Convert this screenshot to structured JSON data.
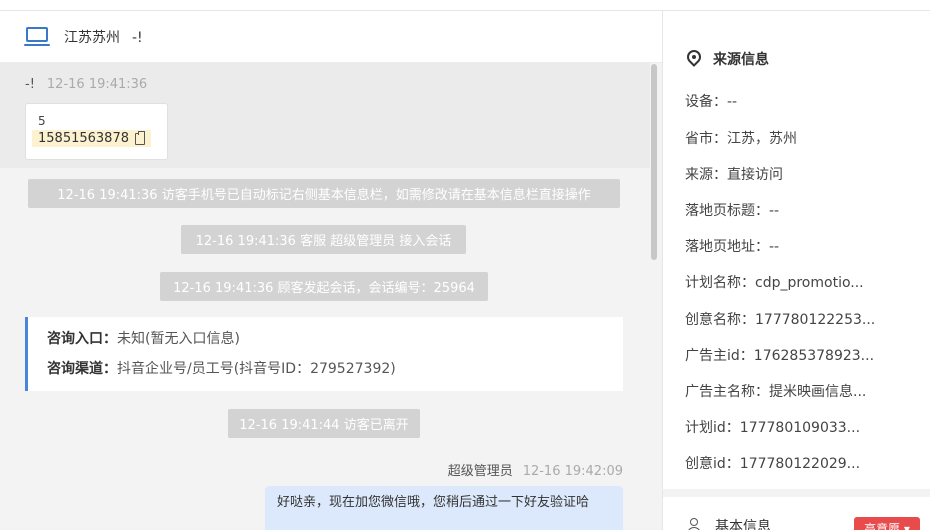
{
  "header": {
    "location": "江苏苏州",
    "suffix": "-!"
  },
  "first_msg": {
    "sender": "-!",
    "time": "12-16 19:41:36",
    "line1": "5",
    "phone": "15851563878"
  },
  "system_messages": [
    "12-16 19:41:36 访客手机号已自动标记右侧基本信息栏，如需修改请在基本信息栏直接操作",
    "12-16 19:41:36 客服 超级管理员 接入会话",
    "12-16 19:41:36 顾客发起会话，会话编号：25964",
    "12-16 19:41:44 访客已离开"
  ],
  "consult": {
    "entry_label": "咨询入口：",
    "entry_value": "未知(暂无入口信息)",
    "channel_label": "咨询渠道：",
    "channel_value": "抖音企业号/员工号(抖音号ID：279527392)"
  },
  "agent_msg": {
    "name": "超级管理员",
    "time": "12-16 19:42:09",
    "text": "好哒亲，现在加您微信哦，您稍后通过一下好友验证哈"
  },
  "side": {
    "title": "来源信息",
    "fields": [
      {
        "label": "设备：",
        "value": "--"
      },
      {
        "label": "省市：",
        "value": "江苏，苏州"
      },
      {
        "label": "来源：",
        "value": "直接访问"
      },
      {
        "label": "落地页标题：",
        "value": "--"
      },
      {
        "label": "落地页地址：",
        "value": "--"
      },
      {
        "label": "计划名称：",
        "value": "cdp_promotio..."
      },
      {
        "label": "创意名称：",
        "value": "177780122253..."
      },
      {
        "label": "广告主id：",
        "value": "176285378923..."
      },
      {
        "label": "广告主名称：",
        "value": "提米映画信息..."
      },
      {
        "label": "计划id：",
        "value": "177780109033..."
      },
      {
        "label": "创意id：",
        "value": "177780122029..."
      }
    ],
    "basic_title": "基本信息",
    "tag": "高意愿 ▾"
  },
  "colors": {
    "accent": "#4a86d8",
    "tag": "#e84b4b",
    "bubble": "#dce8fb",
    "sys": "#d3d3d3"
  }
}
